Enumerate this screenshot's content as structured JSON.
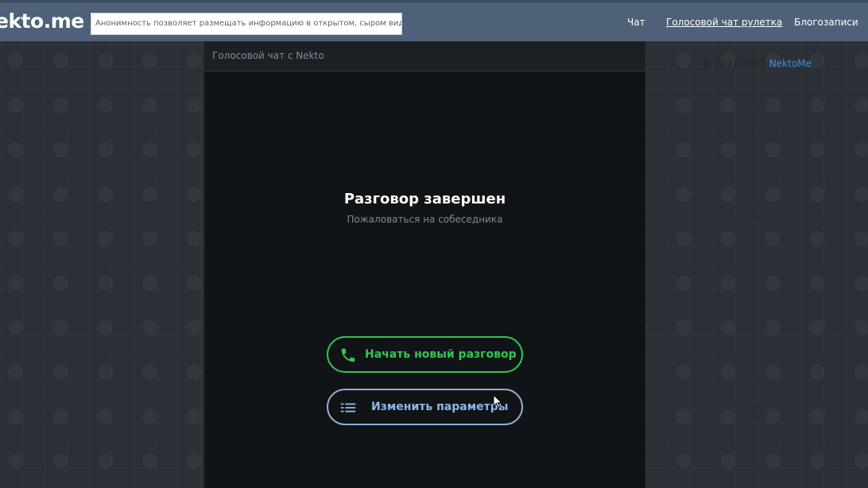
{
  "header": {
    "logo": "ekto.me",
    "slogan": "Анонимность позволяет размещать информацию в открытом, сыром виде!",
    "nav": [
      {
        "label": "Чат"
      },
      {
        "label": "Голосовой чат рулетка"
      },
      {
        "label": "Блогозаписи"
      }
    ]
  },
  "sidebar": {
    "copyright_prefix": "© 2011-2022",
    "copyright_brand": "NektoMe"
  },
  "panel": {
    "title": "Голосовой чат с Nekto",
    "status_title": "Разговор завершен",
    "complain_link": "Пожаловаться на собеседника",
    "new_chat_button": "Начать новый разговор",
    "change_params_button": "Изменить параметры"
  },
  "colors": {
    "header_bg": "#4e6178",
    "panel_bg": "#111417",
    "accent_green": "#33c24d",
    "accent_blue": "#8fb0d8",
    "link_blue": "#4a8fd6"
  },
  "icons": {
    "new_chat": "phone-icon",
    "change_params": "menu-icon"
  }
}
